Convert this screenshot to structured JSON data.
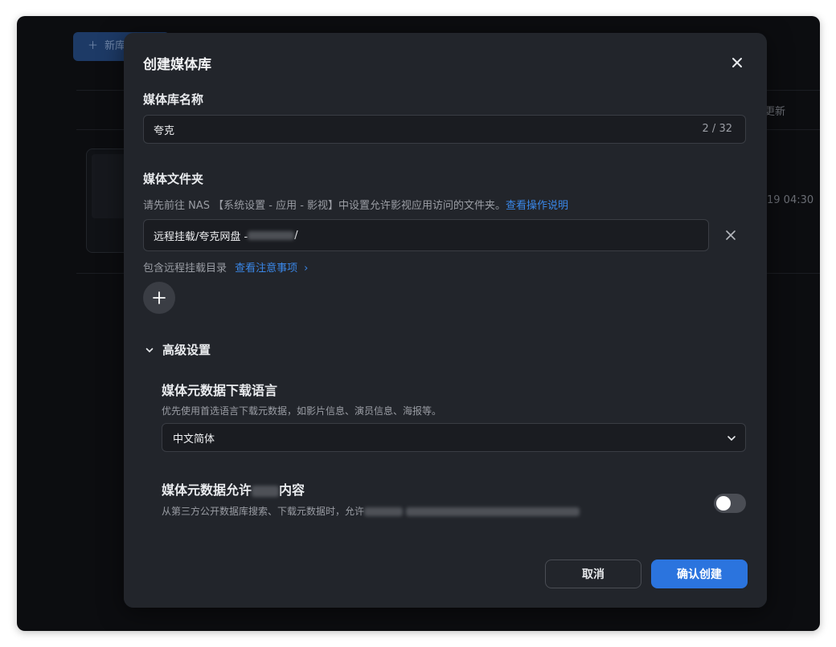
{
  "background": {
    "new_button_label": "新库",
    "column_header": "更新",
    "row_time": "19 04:30"
  },
  "modal": {
    "title": "创建媒体库",
    "name_section": {
      "label": "媒体库名称",
      "value": "夸克",
      "counter": "2 / 32"
    },
    "folder_section": {
      "label": "媒体文件夹",
      "hint_prefix": "请先前往 NAS 【系统设置 - 应用 - 影视】中设置允许影视应用访问的文件夹。",
      "hint_link": "查看操作说明",
      "folder_prefix": "远程挂载/夸克网盘 - ",
      "folder_suffix": "/",
      "remote_note": "包含远程挂载目录",
      "remote_link": "查看注意事项"
    },
    "advanced": {
      "label": "高级设置",
      "language": {
        "title": "媒体元数据下载语言",
        "desc": "优先使用首选语言下载元数据，如影片信息、演员信息、海报等。",
        "selected": "中文简体"
      },
      "adult": {
        "title_prefix": "媒体元数据允许",
        "title_suffix": "内容",
        "desc_prefix": "从第三方公开数据库搜索、下载元数据时，允许",
        "enabled": false
      }
    },
    "footer": {
      "cancel_label": "取消",
      "confirm_label": "确认创建"
    }
  },
  "colors": {
    "accent": "#2b74de",
    "link": "#3a87e8",
    "modal_bg": "#22252b"
  }
}
